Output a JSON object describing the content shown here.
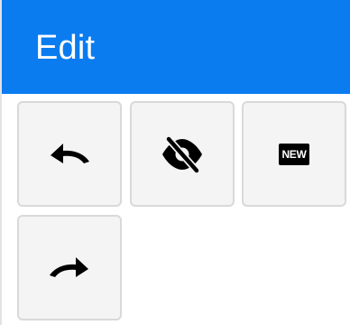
{
  "panel": {
    "title": "Edit",
    "accent_color": "#0a7cf0"
  },
  "toolbar": {
    "buttons": [
      {
        "name": "undo",
        "icon": "undo-icon"
      },
      {
        "name": "hide",
        "icon": "eye-off-icon"
      },
      {
        "name": "new",
        "icon": "new-badge-icon",
        "badge_text": "NEW"
      },
      {
        "name": "redo",
        "icon": "redo-icon"
      }
    ]
  }
}
